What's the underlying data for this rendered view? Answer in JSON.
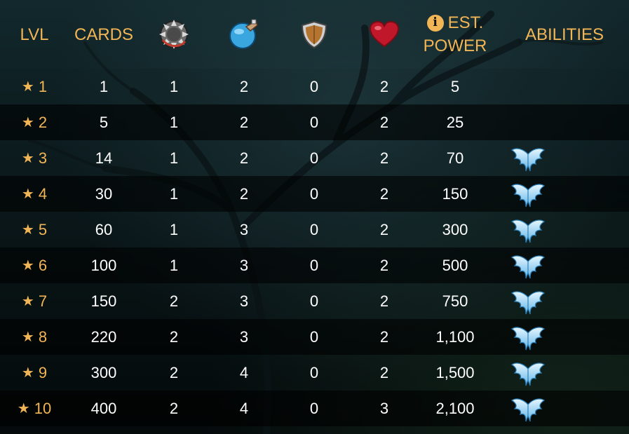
{
  "header": {
    "lvl": "LVL",
    "cards": "CARDS",
    "speed_icon": "sawblade-speed-icon",
    "attack_icon": "magic-orb-attack-icon",
    "armor_icon": "shield-armor-icon",
    "health_icon": "heart-health-icon",
    "info_icon": "i",
    "est_line1": "EST.",
    "est_line2": "POWER",
    "abilities": "ABILITIES"
  },
  "colors": {
    "accent": "#f2b556",
    "text": "#ffffff",
    "ability": "#9fd8ff"
  },
  "rows": [
    {
      "lvl": "1",
      "cards": "1",
      "speed": "1",
      "attack": "2",
      "armor": "0",
      "health": "2",
      "power": "5",
      "ability": false
    },
    {
      "lvl": "2",
      "cards": "5",
      "speed": "1",
      "attack": "2",
      "armor": "0",
      "health": "2",
      "power": "25",
      "ability": false
    },
    {
      "lvl": "3",
      "cards": "14",
      "speed": "1",
      "attack": "2",
      "armor": "0",
      "health": "2",
      "power": "70",
      "ability": true
    },
    {
      "lvl": "4",
      "cards": "30",
      "speed": "1",
      "attack": "2",
      "armor": "0",
      "health": "2",
      "power": "150",
      "ability": true
    },
    {
      "lvl": "5",
      "cards": "60",
      "speed": "1",
      "attack": "3",
      "armor": "0",
      "health": "2",
      "power": "300",
      "ability": true
    },
    {
      "lvl": "6",
      "cards": "100",
      "speed": "1",
      "attack": "3",
      "armor": "0",
      "health": "2",
      "power": "500",
      "ability": true
    },
    {
      "lvl": "7",
      "cards": "150",
      "speed": "2",
      "attack": "3",
      "armor": "0",
      "health": "2",
      "power": "750",
      "ability": true
    },
    {
      "lvl": "8",
      "cards": "220",
      "speed": "2",
      "attack": "3",
      "armor": "0",
      "health": "2",
      "power": "1,100",
      "ability": true
    },
    {
      "lvl": "9",
      "cards": "300",
      "speed": "2",
      "attack": "4",
      "armor": "0",
      "health": "2",
      "power": "1,500",
      "ability": true
    },
    {
      "lvl": "10",
      "cards": "400",
      "speed": "2",
      "attack": "4",
      "armor": "0",
      "health": "3",
      "power": "2,100",
      "ability": true
    }
  ],
  "ability_icon": "winged-ability-icon",
  "star_glyph": "★"
}
